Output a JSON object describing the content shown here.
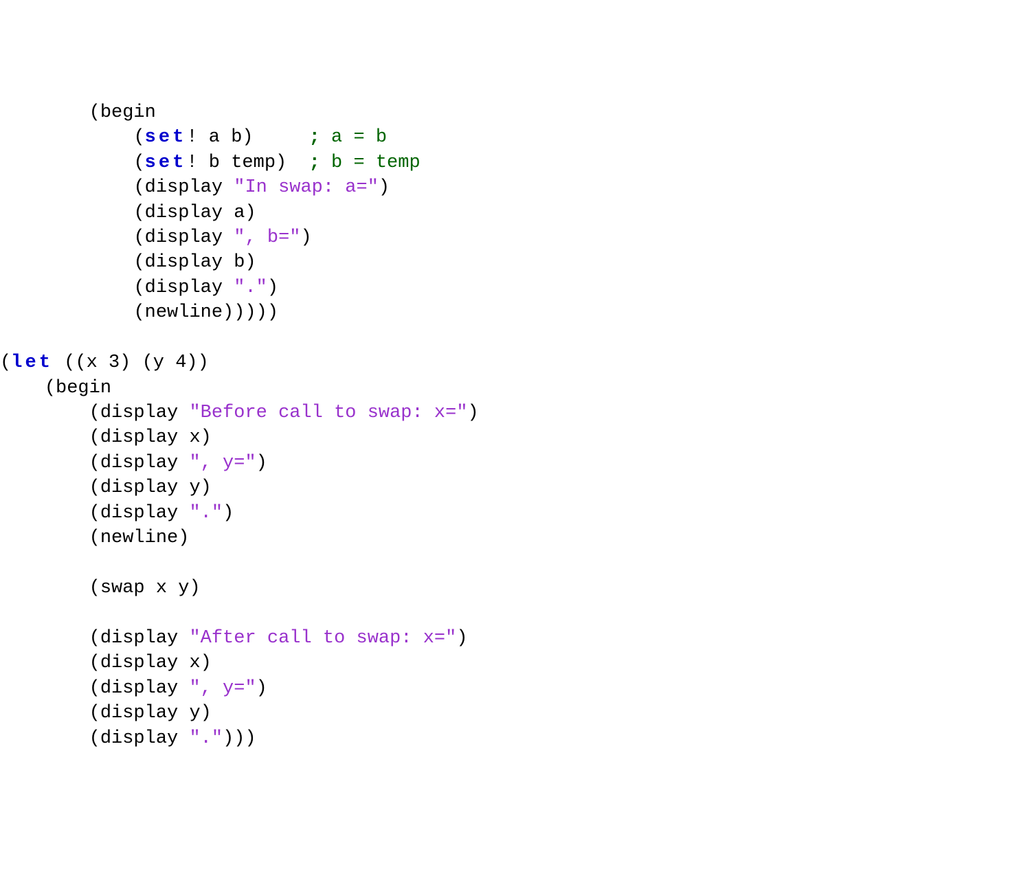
{
  "code": {
    "lines": [
      {
        "indent": 8,
        "tokens": [
          {
            "type": "normal",
            "text": "(begin"
          }
        ]
      },
      {
        "indent": 12,
        "tokens": [
          {
            "type": "normal",
            "text": "("
          },
          {
            "type": "keyword",
            "text": "set",
            "spaced": true
          },
          {
            "type": "normal",
            "text": "! a b)     "
          },
          {
            "type": "comment-bold",
            "text": ";"
          },
          {
            "type": "comment",
            "text": " a = b"
          }
        ]
      },
      {
        "indent": 12,
        "tokens": [
          {
            "type": "normal",
            "text": "("
          },
          {
            "type": "keyword",
            "text": "set",
            "spaced": true
          },
          {
            "type": "normal",
            "text": "! b temp)  "
          },
          {
            "type": "comment-bold",
            "text": ";"
          },
          {
            "type": "comment",
            "text": " b = temp"
          }
        ]
      },
      {
        "indent": 12,
        "tokens": [
          {
            "type": "normal",
            "text": "(display "
          },
          {
            "type": "string",
            "text": "\"In swap: a=\""
          },
          {
            "type": "normal",
            "text": ")"
          }
        ]
      },
      {
        "indent": 12,
        "tokens": [
          {
            "type": "normal",
            "text": "(display a)"
          }
        ]
      },
      {
        "indent": 12,
        "tokens": [
          {
            "type": "normal",
            "text": "(display "
          },
          {
            "type": "string",
            "text": "\", b=\""
          },
          {
            "type": "normal",
            "text": ")"
          }
        ]
      },
      {
        "indent": 12,
        "tokens": [
          {
            "type": "normal",
            "text": "(display b)"
          }
        ]
      },
      {
        "indent": 12,
        "tokens": [
          {
            "type": "normal",
            "text": "(display "
          },
          {
            "type": "string",
            "text": "\".\""
          },
          {
            "type": "normal",
            "text": ")"
          }
        ]
      },
      {
        "indent": 12,
        "tokens": [
          {
            "type": "normal",
            "text": "(newline)))))"
          }
        ]
      },
      {
        "indent": 0,
        "tokens": []
      },
      {
        "indent": 0,
        "tokens": [
          {
            "type": "normal",
            "text": "("
          },
          {
            "type": "keyword",
            "text": "let",
            "spaced": true
          },
          {
            "type": "normal",
            "text": " ((x 3) (y 4))"
          }
        ]
      },
      {
        "indent": 4,
        "tokens": [
          {
            "type": "normal",
            "text": "(begin"
          }
        ]
      },
      {
        "indent": 8,
        "tokens": [
          {
            "type": "normal",
            "text": "(display "
          },
          {
            "type": "string",
            "text": "\"Before call to swap: x=\""
          },
          {
            "type": "normal",
            "text": ")"
          }
        ]
      },
      {
        "indent": 8,
        "tokens": [
          {
            "type": "normal",
            "text": "(display x)"
          }
        ]
      },
      {
        "indent": 8,
        "tokens": [
          {
            "type": "normal",
            "text": "(display "
          },
          {
            "type": "string",
            "text": "\", y=\""
          },
          {
            "type": "normal",
            "text": ")"
          }
        ]
      },
      {
        "indent": 8,
        "tokens": [
          {
            "type": "normal",
            "text": "(display y)"
          }
        ]
      },
      {
        "indent": 8,
        "tokens": [
          {
            "type": "normal",
            "text": "(display "
          },
          {
            "type": "string",
            "text": "\".\""
          },
          {
            "type": "normal",
            "text": ")"
          }
        ]
      },
      {
        "indent": 8,
        "tokens": [
          {
            "type": "normal",
            "text": "(newline)"
          }
        ]
      },
      {
        "indent": 0,
        "tokens": []
      },
      {
        "indent": 8,
        "tokens": [
          {
            "type": "normal",
            "text": "(swap x y)"
          }
        ]
      },
      {
        "indent": 0,
        "tokens": []
      },
      {
        "indent": 8,
        "tokens": [
          {
            "type": "normal",
            "text": "(display "
          },
          {
            "type": "string",
            "text": "\"After call to swap: x=\""
          },
          {
            "type": "normal",
            "text": ")"
          }
        ]
      },
      {
        "indent": 8,
        "tokens": [
          {
            "type": "normal",
            "text": "(display x)"
          }
        ]
      },
      {
        "indent": 8,
        "tokens": [
          {
            "type": "normal",
            "text": "(display "
          },
          {
            "type": "string",
            "text": "\", y=\""
          },
          {
            "type": "normal",
            "text": ")"
          }
        ]
      },
      {
        "indent": 8,
        "tokens": [
          {
            "type": "normal",
            "text": "(display y)"
          }
        ]
      },
      {
        "indent": 8,
        "tokens": [
          {
            "type": "normal",
            "text": "(display "
          },
          {
            "type": "string",
            "text": "\".\""
          },
          {
            "type": "normal",
            "text": ")))"
          }
        ]
      }
    ]
  }
}
